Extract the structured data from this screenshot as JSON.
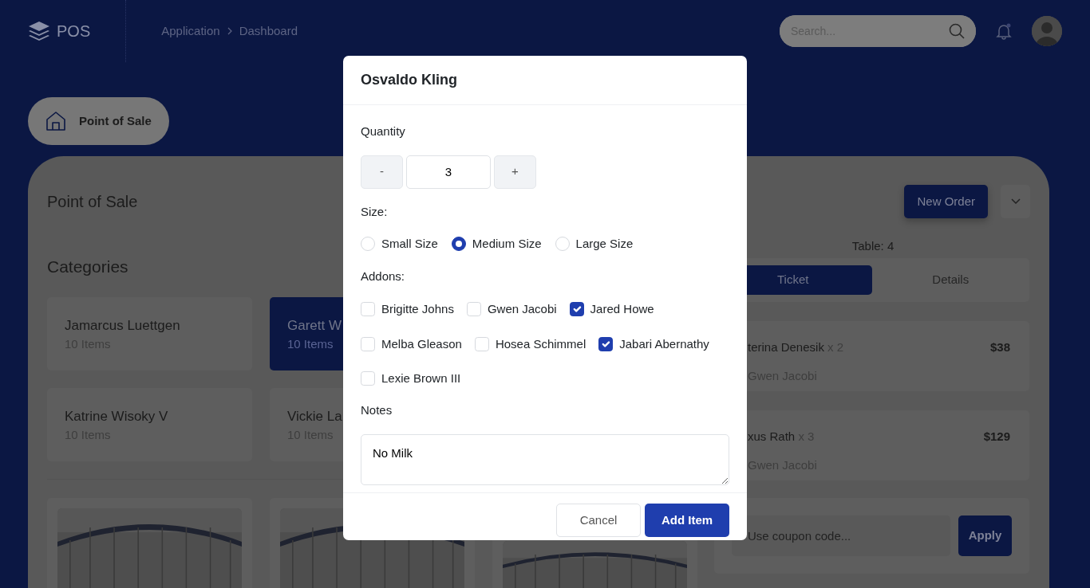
{
  "header": {
    "logo": "POS",
    "breadcrumb": [
      "Application",
      "Dashboard"
    ],
    "search": {
      "placeholder": "Search..."
    }
  },
  "nav_pill": {
    "label": "Point of Sale"
  },
  "page_title": "Point of Sale",
  "new_order_button": "New Order",
  "categories": {
    "title": "Categories",
    "items": [
      {
        "name": "Jamarcus Luettgen",
        "count": "10 Items",
        "selected": false
      },
      {
        "name": "Garett W",
        "count": "10 Items",
        "selected": true
      },
      {
        "name": "Katrine Wisoky V",
        "count": "10 Items",
        "selected": false
      },
      {
        "name": "Vickie La",
        "count": "10 Items",
        "selected": false
      }
    ]
  },
  "order": {
    "table": "Table: 4",
    "tabs": [
      {
        "label": "Ticket",
        "selected": true
      },
      {
        "label": "Details",
        "selected": false
      }
    ],
    "items": [
      {
        "name": "terina Denesik",
        "qty": "x 2",
        "price": "$38",
        "addon": "Gwen Jacobi"
      },
      {
        "name": "xus Rath",
        "qty": "x 3",
        "price": "$129",
        "addon": "Gwen Jacobi"
      }
    ],
    "coupon": {
      "placeholder": "Use coupon code...",
      "button": "Apply"
    }
  },
  "modal": {
    "title": "Osvaldo Kling",
    "quantity_label": "Quantity",
    "quantity": {
      "decrement": "-",
      "value": "3",
      "increment": "+"
    },
    "size_label": "Size:",
    "sizes": [
      {
        "label": "Small Size",
        "selected": false
      },
      {
        "label": "Medium Size",
        "selected": true
      },
      {
        "label": "Large Size",
        "selected": false
      }
    ],
    "addons_label": "Addons:",
    "addons": [
      {
        "label": "Brigitte Johns",
        "checked": false
      },
      {
        "label": "Gwen Jacobi",
        "checked": false
      },
      {
        "label": "Jared Howe",
        "checked": true
      },
      {
        "label": "Melba Gleason",
        "checked": false
      },
      {
        "label": "Hosea Schimmel",
        "checked": false
      },
      {
        "label": "Jabari Abernathy",
        "checked": true
      },
      {
        "label": "Lexie Brown III",
        "checked": false
      }
    ],
    "notes_label": "Notes",
    "notes": "No Milk",
    "buttons": [
      {
        "label": "Cancel",
        "kind": "secondary"
      },
      {
        "label": "Add Item",
        "kind": "primary"
      }
    ]
  }
}
